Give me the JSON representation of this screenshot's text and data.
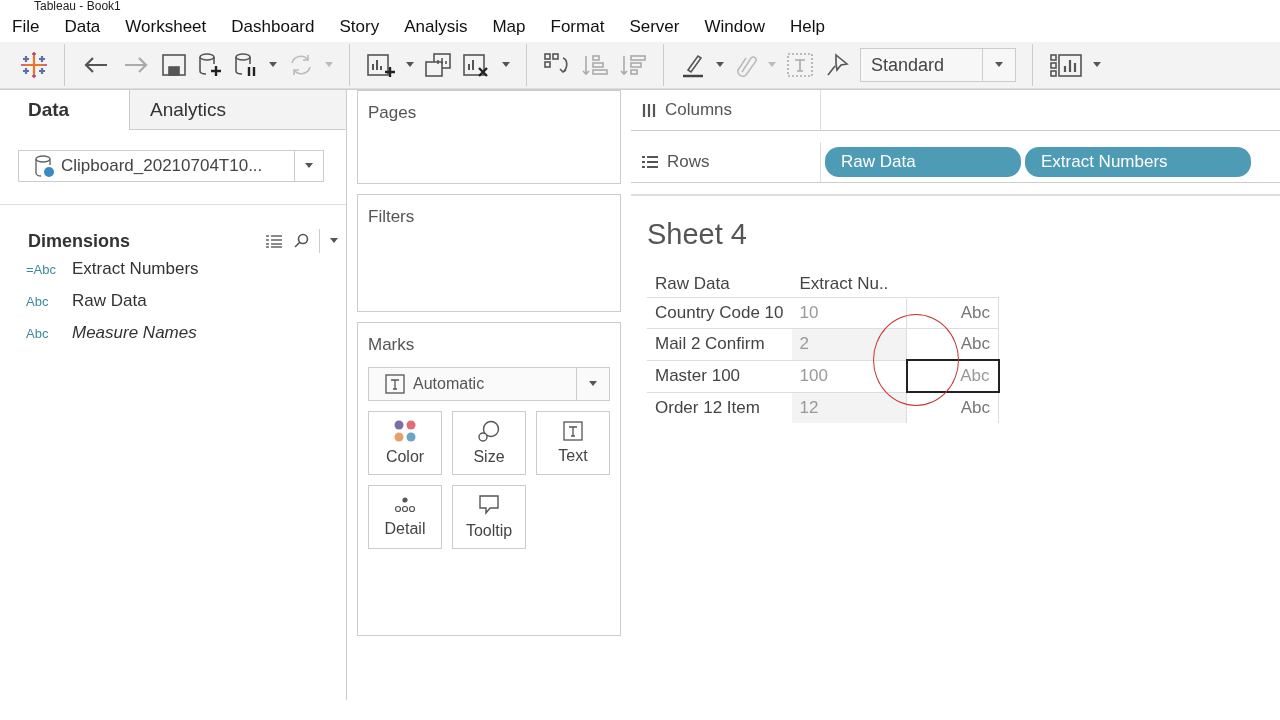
{
  "window": {
    "title": "Tableau - Book1"
  },
  "menu": [
    "File",
    "Data",
    "Worksheet",
    "Dashboard",
    "Story",
    "Analysis",
    "Map",
    "Format",
    "Server",
    "Window",
    "Help"
  ],
  "toolbar": {
    "fit": "Standard"
  },
  "data_pane": {
    "tabs": [
      {
        "label": "Data",
        "selected": true
      },
      {
        "label": "Analytics",
        "selected": false
      }
    ],
    "data_source": "Clipboard_20210704T10...",
    "section_title": "Dimensions",
    "fields": [
      {
        "type_label": "=Abc",
        "name": "Extract Numbers",
        "italic": false
      },
      {
        "type_label": "Abc",
        "name": "Raw Data",
        "italic": false
      },
      {
        "type_label": "Abc",
        "name": "Measure Names",
        "italic": true
      }
    ]
  },
  "cards": {
    "pages": "Pages",
    "filters": "Filters",
    "marks": {
      "title": "Marks",
      "mark_type": "Automatic",
      "buttons": [
        {
          "label": "Color",
          "kind": "color"
        },
        {
          "label": "Size",
          "kind": "size"
        },
        {
          "label": "Text",
          "kind": "text"
        },
        {
          "label": "Detail",
          "kind": "detail"
        },
        {
          "label": "Tooltip",
          "kind": "tooltip"
        }
      ]
    }
  },
  "columns_shelf": {
    "label": "Columns"
  },
  "rows_shelf": {
    "label": "Rows",
    "pills": [
      "Raw Data",
      "Extract Numbers"
    ]
  },
  "sheet": {
    "title": "Sheet 4",
    "headers": [
      "Raw Data",
      "Extract Nu.."
    ],
    "rows": [
      {
        "raw": "Country Code 10",
        "extract": "10",
        "mark": "Abc",
        "selected": false
      },
      {
        "raw": "Mail 2 Confirm",
        "extract": "2",
        "mark": "Abc",
        "selected": false
      },
      {
        "raw": "Master 100",
        "extract": "100",
        "mark": "Abc",
        "selected": true
      },
      {
        "raw": "Order 12 Item",
        "extract": "12",
        "mark": "Abc",
        "selected": false
      }
    ]
  }
}
